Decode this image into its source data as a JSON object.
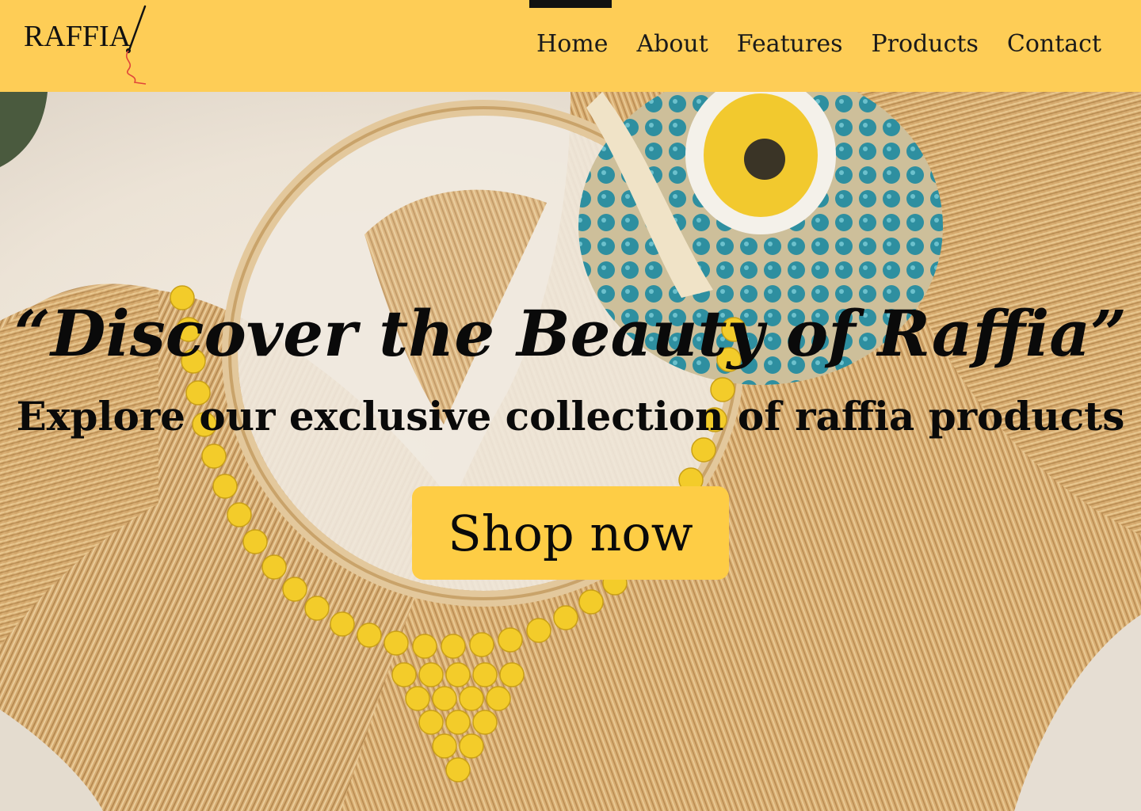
{
  "brand": {
    "name": "RAFFIA",
    "logo_icon": "needle-thread-icon",
    "thread_color": "#e0453a"
  },
  "nav": {
    "items": [
      {
        "label": "Home",
        "active": true
      },
      {
        "label": "About",
        "active": false
      },
      {
        "label": "Features",
        "active": false
      },
      {
        "label": "Products",
        "active": false
      },
      {
        "label": "Contact",
        "active": false
      }
    ]
  },
  "hero": {
    "title": "“Discover the Beauty of Raffia”",
    "subtitle": "Explore our exclusive collection of raffia products",
    "cta_label": "Shop now"
  },
  "colors": {
    "header_bg": "#fecd56",
    "button_bg": "#fecd45",
    "text": "#0a0a0a",
    "raffia": "#d9b27a",
    "bead_yellow": "#f3cc2a",
    "bead_teal": "#2c8a9a"
  }
}
